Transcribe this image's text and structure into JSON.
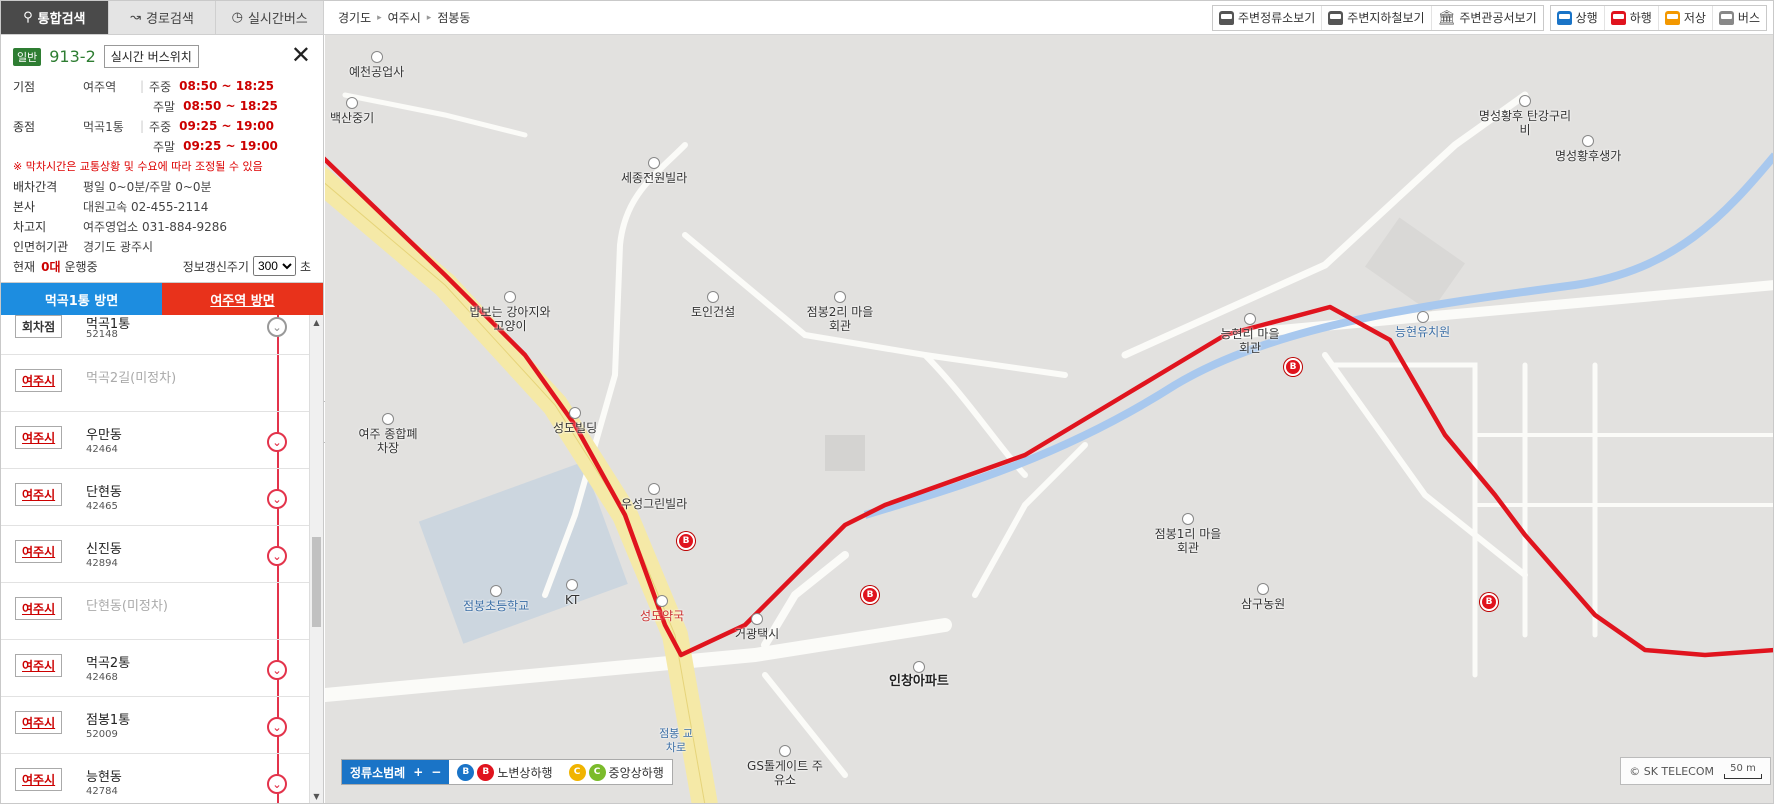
{
  "top_tabs": [
    {
      "label": "통합검색",
      "icon": "search-icon"
    },
    {
      "label": "경로검색",
      "icon": "route-icon"
    },
    {
      "label": "실시간버스",
      "icon": "clock-icon"
    }
  ],
  "breadcrumb": [
    "경기도",
    "여주시",
    "점봉동"
  ],
  "header_buttons": {
    "nearby": [
      "주변정류소보기",
      "주변지하철보기",
      "주변관공서보기"
    ],
    "legend": [
      {
        "label": "상행",
        "color": "#1a74c7"
      },
      {
        "label": "하행",
        "color": "#e0141e"
      },
      {
        "label": "저상",
        "color": "#f39800"
      },
      {
        "label": "버스",
        "color": "#888888"
      }
    ]
  },
  "route": {
    "badge": "일반",
    "number": "913-2",
    "realtime_button": "실시간 버스위치",
    "start": {
      "label": "기점",
      "stop": "여주역",
      "weekday_label": "주중",
      "weekday_time": "08:50 ~ 18:25",
      "weekend_label": "주말",
      "weekend_time": "08:50 ~ 18:25"
    },
    "end": {
      "label": "종점",
      "stop": "먹곡1통",
      "weekday_label": "주중",
      "weekday_time": "09:25 ~ 19:00",
      "weekend_label": "주말",
      "weekend_time": "09:25 ~ 19:00"
    },
    "note": "※ 막차시간은 교통상황 및 수요에 따라 조정될 수 있음",
    "interval_label": "배차간격",
    "interval": "평일 0~0분/주말 0~0분",
    "company_label": "본사",
    "company": "대원고속 02-455-2114",
    "garage_label": "차고지",
    "garage": "여주영업소 031-884-9286",
    "authority_label": "인면허기관",
    "authority": "경기도 광주시",
    "current_prefix": "현재",
    "current_count": "0대",
    "current_suffix": "운행중",
    "refresh_label": "정보갱신주기",
    "refresh_value": "300",
    "refresh_unit": "초"
  },
  "direction_tabs": [
    "먹곡1통 방면",
    "여주역 방면"
  ],
  "stops": [
    {
      "tag": "회차점",
      "name": "먹곡1통",
      "id": "52148",
      "marker": "gray"
    },
    {
      "tag": "여주시",
      "name": "먹곡2길(미정차)",
      "id": "",
      "marker": "none"
    },
    {
      "tag": "여주시",
      "name": "우만동",
      "id": "42464",
      "marker": "red"
    },
    {
      "tag": "여주시",
      "name": "단현동",
      "id": "42465",
      "marker": "red"
    },
    {
      "tag": "여주시",
      "name": "신진동",
      "id": "42894",
      "marker": "red"
    },
    {
      "tag": "여주시",
      "name": "단현동(미정차)",
      "id": "",
      "marker": "none"
    },
    {
      "tag": "여주시",
      "name": "먹곡2통",
      "id": "42468",
      "marker": "red"
    },
    {
      "tag": "여주시",
      "name": "점봉1통",
      "id": "52009",
      "marker": "red"
    },
    {
      "tag": "여주시",
      "name": "능현동",
      "id": "42784",
      "marker": "red"
    }
  ],
  "map": {
    "pois": [
      "예천공업사",
      "백산중기",
      "세종전원빌라",
      "명성황후 탄강구리비",
      "명성황후생가",
      "토인건설",
      "점봉2리 마을회관",
      "능현리 마을회관",
      "능현유치원",
      "밥보는 강아지와고양이",
      "여주 종합폐차장",
      "성도빌딩",
      "우성그린빌라",
      "점봉초등학교",
      "KT",
      "성도약국",
      "거광택시",
      "점봉1리 마을회관",
      "삼구농원",
      "인창아파트",
      "점봉 교차로",
      "GS톨게이트 주유소"
    ],
    "legend_title": "정류소범례",
    "legend_items": [
      "노변상하행",
      "중앙상하행"
    ],
    "copyright": "© SK TELECOM",
    "scale": "50 m"
  }
}
